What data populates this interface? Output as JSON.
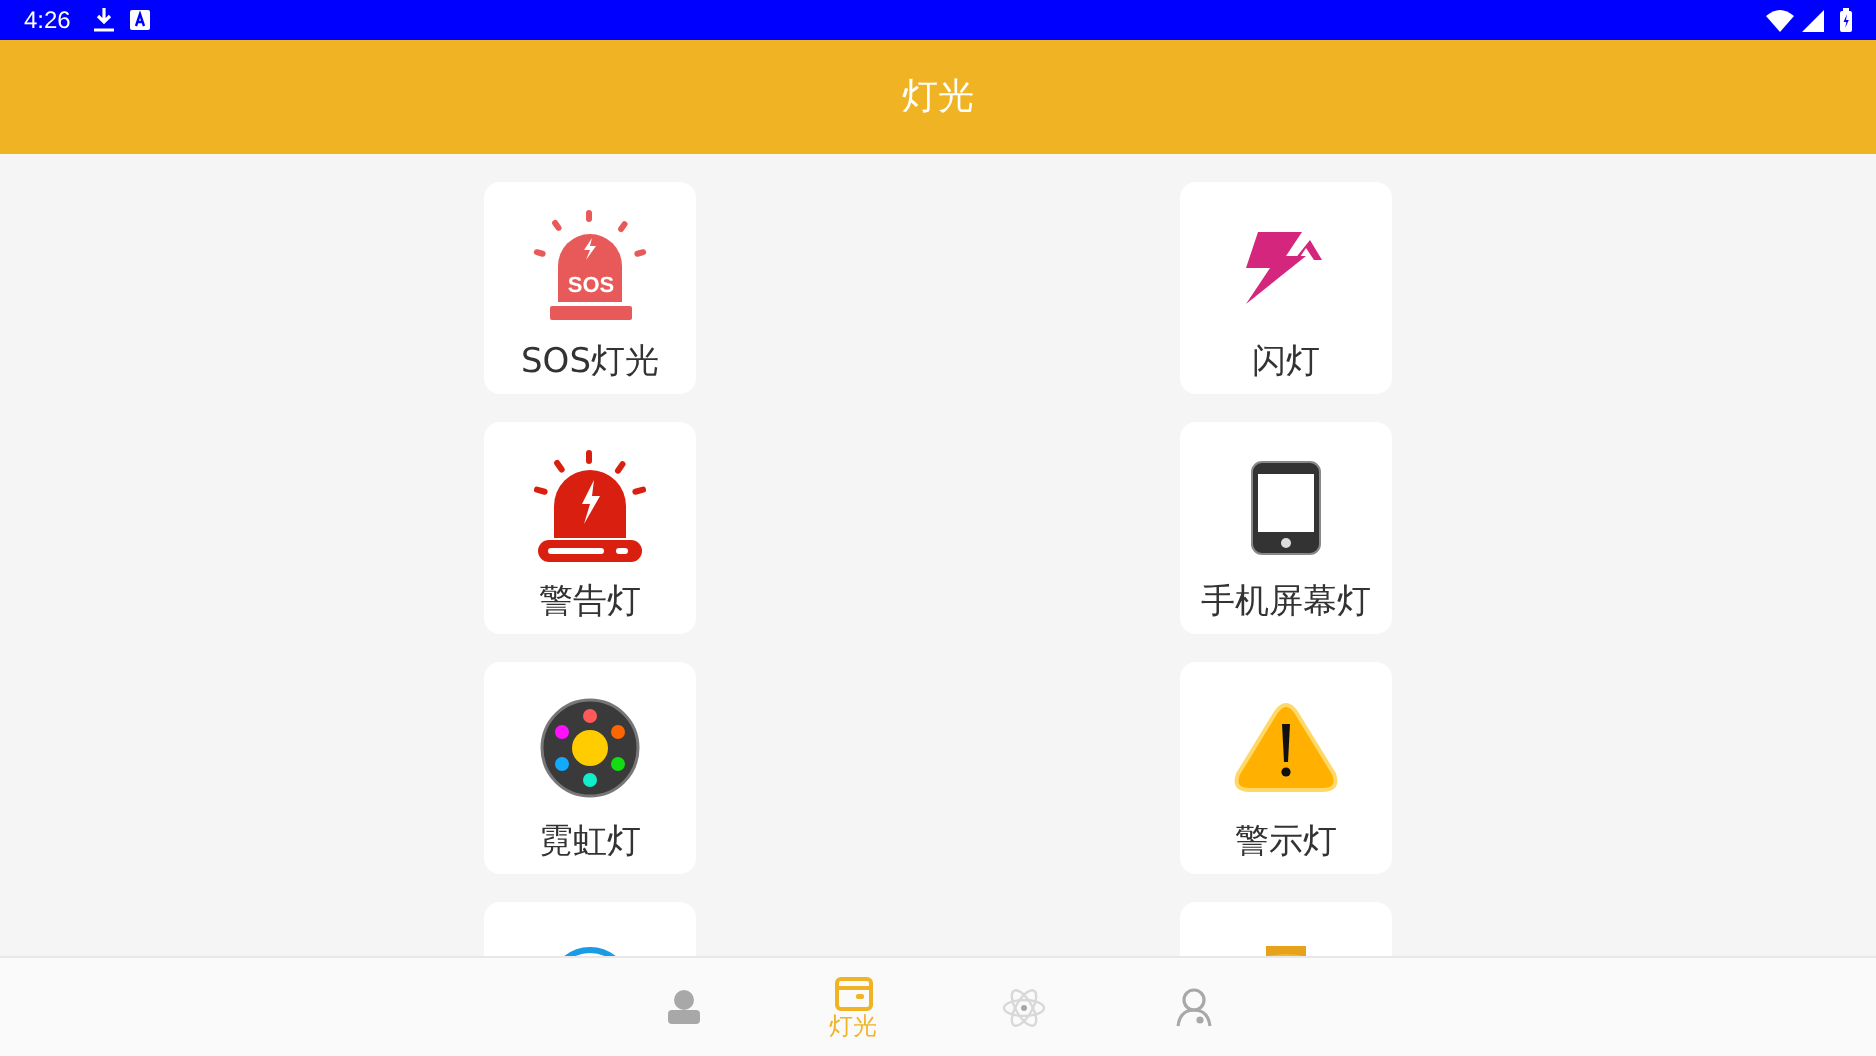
{
  "status_bar": {
    "time": "4:26"
  },
  "app_bar": {
    "title": "灯光"
  },
  "tiles": [
    {
      "kind": "sos",
      "badge": "SOS",
      "label": "SOS灯光"
    },
    {
      "kind": "flash",
      "label": "闪灯"
    },
    {
      "kind": "alarm",
      "label": "警告灯"
    },
    {
      "kind": "phone",
      "label": "手机屏幕灯"
    },
    {
      "kind": "neon",
      "label": "霓虹灯"
    },
    {
      "kind": "warning",
      "label": "警示灯"
    },
    {
      "kind": "ring"
    },
    {
      "kind": "lantern"
    }
  ],
  "bottom_nav": [
    {
      "kind": "person",
      "selected": false
    },
    {
      "kind": "wallet",
      "label": "灯光",
      "selected": true
    },
    {
      "kind": "atom",
      "selected": false
    },
    {
      "kind": "user",
      "selected": false
    }
  ]
}
